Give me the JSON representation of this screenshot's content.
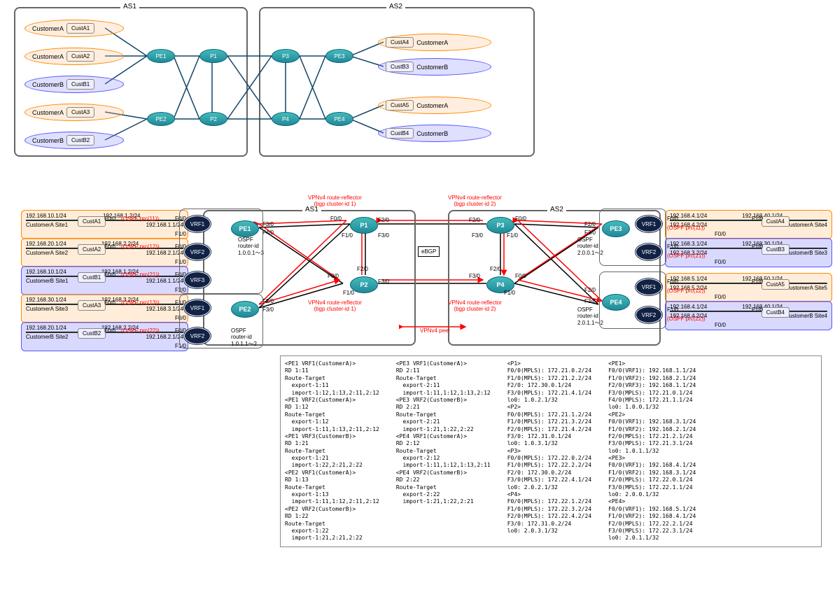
{
  "top": {
    "as1": "AS1",
    "as2": "AS2",
    "pe1": "PE1",
    "pe2": "PE2",
    "pe3": "PE3",
    "pe4": "PE4",
    "p1": "P1",
    "p2": "P2",
    "p3": "P3",
    "p4": "P4",
    "ca": "CustomerA",
    "cb": "CustomerB",
    "a1": "CustA1",
    "a2": "CustA2",
    "a3": "CustA3",
    "a4": "CustA4",
    "a5": "CustA5",
    "b1": "CustB1",
    "b2": "CustB2",
    "b3": "CustB3",
    "b4": "CustB4"
  },
  "mid": {
    "as1": "AS1",
    "as2": "AS2",
    "rr1": "VPNv4 route-reflector\n(bgp cluster-id 1)",
    "rr2": "VPNv4 route-reflector\n(bgp cluster-id 2)",
    "ebgp": "eBGP",
    "peer": "VPNv4 peer",
    "ospf1": "OSPF\nrouter-id\n1.0.0.1～3",
    "ospf2": "OSPF\nrouter-id\n1.0.1.1～2",
    "ospf3": "OSPF\nrouter-id\n2.0.0.1～2",
    "ospf4": "OSPF\nrouter-id\n2.0.1.1～2",
    "vrf1": "VRF1",
    "vrf2": "VRF2",
    "vrf3": "VRF3",
    "s_a1": {
      "ip": "192.168.10.1/24",
      "nm": "CustomerA Site1",
      "c": "CustA1",
      "cif": "F0/0",
      "ospf": "(OSPF prc(11))",
      "pip1": "192.168.1.2/24",
      "pif1": "F0/0",
      "pip2": "192.168.1.1/24",
      "pif2": "F1/0"
    },
    "s_a2": {
      "ip": "192.168.20.1/24",
      "nm": "CustomerA Site2",
      "c": "CustA2",
      "cif": "F0/0",
      "ospf": "(OSPF prc(12))",
      "pip1": "192.168.2.2/24",
      "pif1": "F0/0",
      "pip2": "192.168.2.1/24",
      "pif2": "F1/0"
    },
    "s_b1": {
      "ip": "192.168.10.1/24",
      "nm": "CustomerB Site1",
      "c": "CustB1",
      "cif": "F0/0",
      "ospf": "(OSPF prc(21))",
      "pip1": "192.168.1.2/24",
      "pif1": "F0/0",
      "pip2": "192.168.1.1/24",
      "pif2": "F2/0"
    },
    "s_a3": {
      "ip": "192.168.30.1/24",
      "nm": "CustomerA Site3",
      "c": "CustA3",
      "cif": "F0/0",
      "ospf": "(OSPF prc(13))",
      "pip1": "192.168.3.2/24",
      "pif1": "F1/0",
      "pip2": "192.168.3.1/24",
      "pif2": "F0/0"
    },
    "s_b2": {
      "ip": "192.168.20.1/24",
      "nm": "CustomerB Site2",
      "c": "CustB2",
      "cif": "F0/0",
      "ospf": "(OSPF prc(22))",
      "pip1": "192.168.2.2/24",
      "pif1": "F0/0",
      "pip2": "192.168.2.1/24",
      "pif2": "F1/0"
    },
    "s_a4": {
      "ip": "192.168.40.1/24",
      "nm": "CustomerA Site4",
      "c": "CustA4",
      "cif": "F1/0",
      "ospf": "(OSPF prc(11))",
      "pip1": "192.168.4.1/24",
      "pif1": "F0/0",
      "pip2": "192.168.4.2/24",
      "pif2": "F0/0"
    },
    "s_b3": {
      "ip": "192.168.30.1/24",
      "nm": "CustomerB Site3",
      "c": "CustB3",
      "cif": "F1/0",
      "ospf": "(OSPF prc(21))",
      "pip1": "192.168.3.1/24",
      "pif1": "F1/0",
      "pip2": "192.168.3.2/24",
      "pif2": "F0/0"
    },
    "s_a5": {
      "ip": "192.168.50.1/24",
      "nm": "CustomerA Site5",
      "c": "CustA5",
      "cif": "F1/0",
      "ospf": "(OSPF prc(12))",
      "pip1": "192.168.5.1/24",
      "pif1": "F0/0",
      "pip2": "192.168.5.2/24",
      "pif2": "F0/0"
    },
    "s_b4": {
      "ip": "192.168.40.1/24",
      "nm": "CustomerB Site4",
      "c": "CustB4",
      "cif": "F1/0",
      "ospf": "(OSPF prc(22))",
      "pip1": "192.168.4.1/24",
      "pif1": "F1/0",
      "pip2": "192.168.4.2/24",
      "pif2": "F0/0"
    },
    "if": {
      "f00": "F0/0",
      "f10": "F1/0",
      "f20": "F2/0",
      "f30": "F3/0",
      "f40": "F4/0"
    }
  },
  "cfg": {
    "c1": "<PE1 VRF1(CustomerA)>\nRD 1:11\nRoute-Target\n  export-1:11\n  import-1:12,1:13,2:11,2:12\n<PE1 VRF2(CustomerA)>\nRD 1:12\nRoute-Target\n  export-1:12\n  import-1:11,1:13,2:11,2:12\n<PE1 VRF3(CustomerB)>\nRD 1:21\nRoute-Target\n  export-1:21\n  import-1:22,2:21,2:22\n<PE2 VRF1(CustomerA)>\nRD 1:13\nRoute-Target\n  export-1:13\n  import-1:11,1:12,2:11,2:12\n<PE2 VRF2(CustomerB)>\nRD 1:22\nRoute-Target\n  export-1:22\n  import-1:21,2:21,2:22",
    "c2": "<PE3 VRF1(CustomerA)>\nRD 2:11\nRoute-Target\n  export-2:11\n  import-1:11,1:12,1:13,2:12\n<PE3 VRF2(CustomerB)>\nRD 2:21\nRoute-Target\n  export-2:21\n  import-1:21,1:22,2:22\n<PE4 VRF1(CustomerA)>\nRD 2:12\nRoute-Target\n  export-2:12\n  import-1:11,1:12,1:13,2:11\n<PE4 VRF2(CustomerB)>\nRD 2:22\nRoute-Target\n  export-2:22\n  import-1:21,1:22,2:21",
    "c3": "<P1>\nF0/0(MPLS): 172.21.0.2/24\nF1/0(MPLS): 172.21.2.2/24\nF2/0: 172.30.0.1/24\nF3/0(MPLS): 172.21.4.1/24\nlo0: 1.0.2.1/32\n<P2>\nF0/0(MPLS): 172.21.1.2/24\nF1/0(MPLS): 172.21.3.2/24\nF2/0(MPLS): 172.21.4.2/24\nF3/0: 172.31.0.1/24\nlo0: 1.0.3.1/32\n<P3>\nF0/0(MPLS): 172.22.0.2/24\nF1/0(MPLS): 172.22.2.2/24\nF2/0: 172.30.0.2/24\nF3/0(MPLS): 172.22.4.1/24\nlo0: 2.0.2.1/32\n<P4>\nF0/0(MPLS): 172.22.1.2/24\nF1/0(MPLS): 172.22.3.2/24\nF2/0(MPLS): 172.22.4.2/24\nF3/0: 172.31.0.2/24\nlo0: 2.0.3.1/32",
    "c4": "<PE1>\nF0/0(VRF1): 192.168.1.1/24\nF1/0(VRF2): 192.168.2.1/24\nF2/0(VRF3): 192.168.1.1/24\nF3/0(MPLS): 172.21.0.1/24\nF4/0(MPLS): 172.21.1.1/24\nlo0: 1.0.0.1/32\n<PE2>\nF0/0(VRF1): 192.168.3.1/24\nF1/0(VRF2): 192.168.2.1/24\nF2/0(MPLS): 172.21.2.1/24\nF3/0(MPLS): 172.21.3.1/24\nlo0: 1.0.1.1/32\n<PE3>\nF0/0(VRF1): 192.168.4.1/24\nF1/0(VRF2): 192.168.3.1/24\nF2/0(MPLS): 172.22.0.1/24\nF3/0(MPLS): 172.22.1.1/24\nlo0: 2.0.0.1/32\n<PE4>\nF0/0(VRF1): 192.168.5.1/24\nF1/0(VRF2): 192.168.4.1/24\nF2/0(MPLS): 172.22.2.1/24\nF3/0(MPLS): 172.22.3.1/24\nlo0: 2.0.1.1/32"
  }
}
